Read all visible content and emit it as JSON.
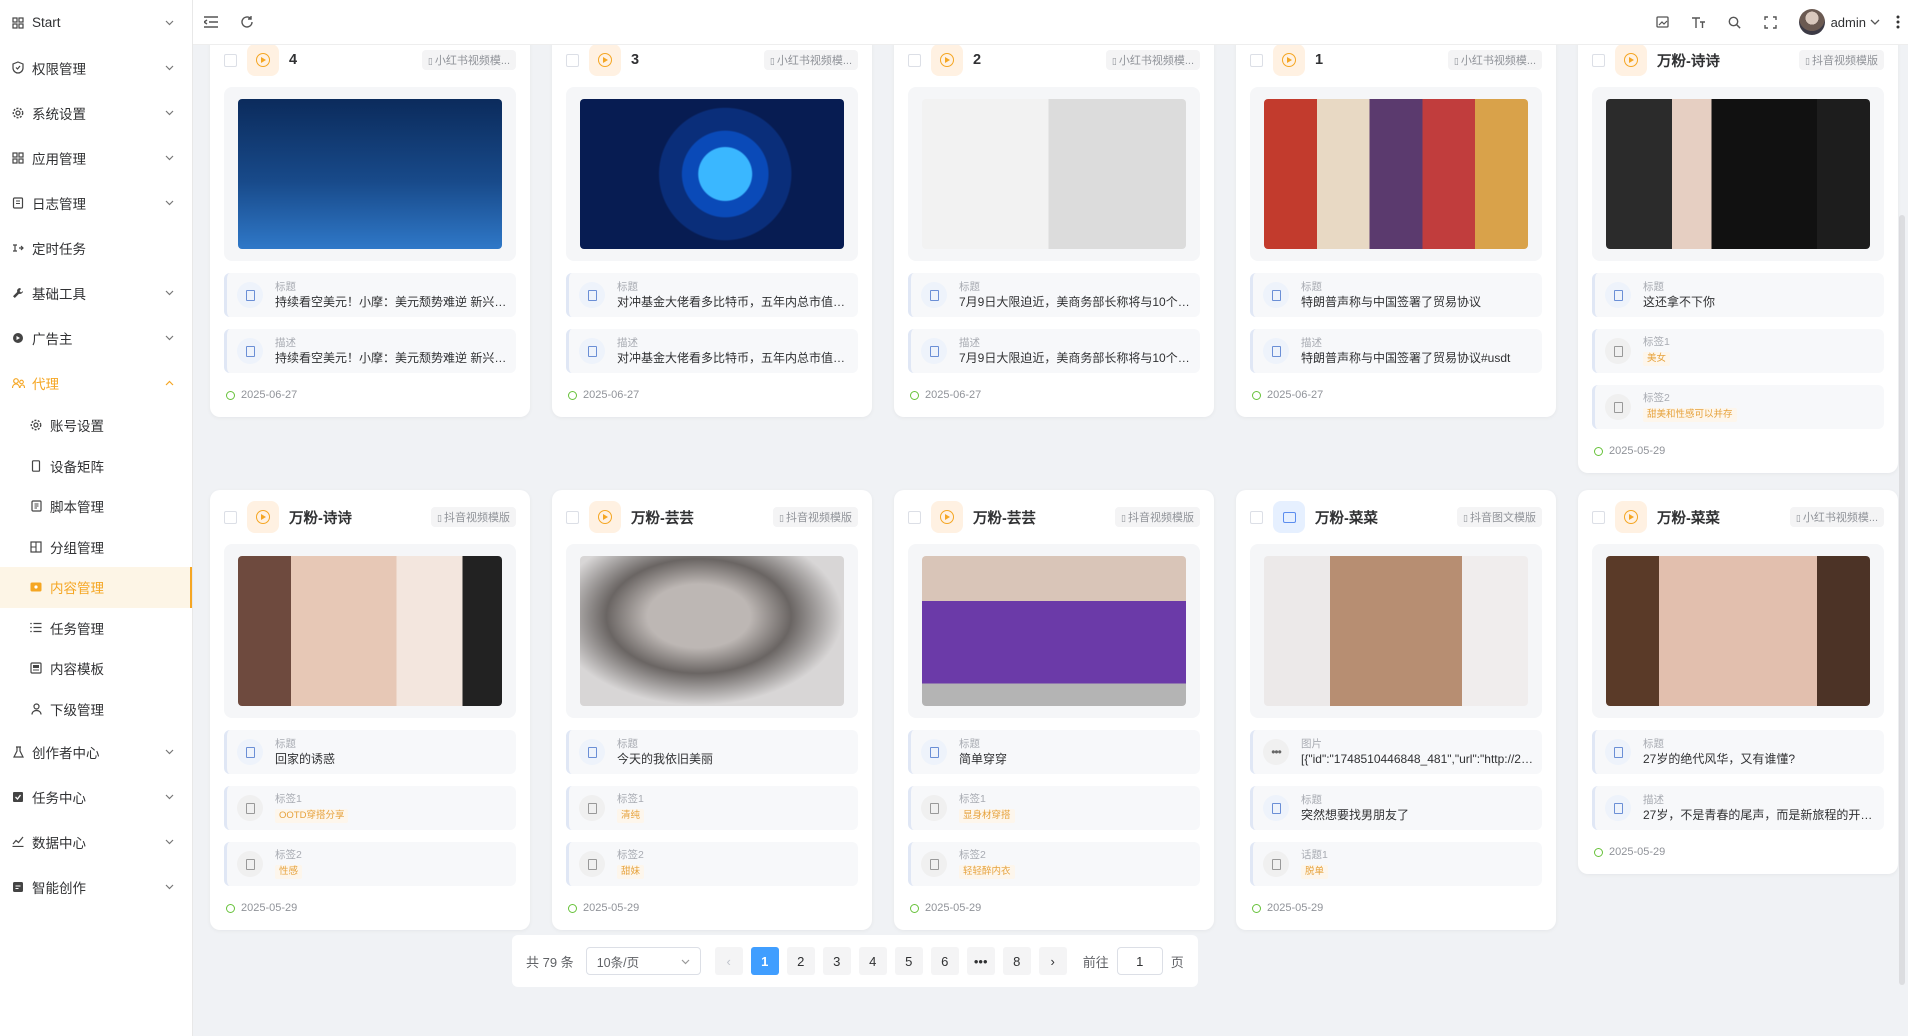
{
  "sidebar": {
    "items": [
      {
        "label": "Start",
        "icon": "grid-icon",
        "has_arrow": true
      },
      {
        "label": "权限管理",
        "icon": "shield-icon",
        "has_arrow": true
      },
      {
        "label": "系统设置",
        "icon": "gear-icon",
        "has_arrow": true
      },
      {
        "label": "应用管理",
        "icon": "grid-icon",
        "has_arrow": true
      },
      {
        "label": "日志管理",
        "icon": "log-icon",
        "has_arrow": true
      },
      {
        "label": "定时任务",
        "icon": "timer-icon",
        "has_arrow": false
      },
      {
        "label": "基础工具",
        "icon": "wrench-icon",
        "has_arrow": true
      },
      {
        "label": "广告主",
        "icon": "ad-icon",
        "has_arrow": true
      },
      {
        "label": "代理",
        "icon": "agent-icon",
        "has_arrow": true,
        "open": true
      }
    ],
    "sub_items": [
      {
        "label": "账号设置",
        "icon": "gear-icon"
      },
      {
        "label": "设备矩阵",
        "icon": "phone-icon"
      },
      {
        "label": "脚本管理",
        "icon": "script-icon"
      },
      {
        "label": "分组管理",
        "icon": "group-icon"
      },
      {
        "label": "内容管理",
        "icon": "content-icon",
        "active": true
      },
      {
        "label": "任务管理",
        "icon": "list-icon"
      },
      {
        "label": "内容模板",
        "icon": "template-icon"
      },
      {
        "label": "下级管理",
        "icon": "user-icon"
      }
    ],
    "bottom_items": [
      {
        "label": "创作者中心",
        "icon": "creator-icon",
        "has_arrow": true
      },
      {
        "label": "任务中心",
        "icon": "task-icon",
        "has_arrow": true
      },
      {
        "label": "数据中心",
        "icon": "chart-icon",
        "has_arrow": true
      },
      {
        "label": "智能创作",
        "icon": "ai-icon",
        "has_arrow": true
      }
    ]
  },
  "header": {
    "user": "admin"
  },
  "cards": [
    {
      "name": "4",
      "type": "video",
      "badge": "小红书视频模...",
      "thumb": "thumb-stock",
      "fields": [
        {
          "label": "标题",
          "value": "持续看空美元！小摩：美元颓势难逆 新兴市..."
        },
        {
          "label": "描述",
          "value": "持续看空美元！小摩：美元颓势难逆 新兴市..."
        }
      ],
      "date": "2025-06-27"
    },
    {
      "name": "3",
      "type": "video",
      "badge": "小红书视频模...",
      "thumb": "thumb-bitcoin",
      "fields": [
        {
          "label": "标题",
          "value": "对冲基金大佬看多比特币，五年内总市值将..."
        },
        {
          "label": "描述",
          "value": "对冲基金大佬看多比特币，五年内总市值将..."
        }
      ],
      "date": "2025-06-27"
    },
    {
      "name": "2",
      "type": "video",
      "badge": "小红书视频模...",
      "thumb": "thumb-cartoon",
      "fields": [
        {
          "label": "标题",
          "value": "7月9日大限迫近，美商务部长称将与10个主..."
        },
        {
          "label": "描述",
          "value": "7月9日大限迫近，美商务部长称将与10个主..."
        }
      ],
      "date": "2025-06-27"
    },
    {
      "name": "1",
      "type": "video",
      "badge": "小红书视频模...",
      "thumb": "thumb-news",
      "fields": [
        {
          "label": "标题",
          "value": "特朗普声称与中国签署了贸易协议"
        },
        {
          "label": "描述",
          "value": "特朗普声称与中国签署了贸易协议#usdt"
        }
      ],
      "date": "2025-06-27"
    },
    {
      "name": "万粉-诗诗",
      "type": "video",
      "badge": "抖音视频模版",
      "thumb": "thumb-black",
      "fields": [
        {
          "label": "标题",
          "value": "这还拿不下你"
        },
        {
          "label": "标签1",
          "tag": "美女"
        },
        {
          "label": "标签2",
          "tag": "甜美和性感可以并存"
        }
      ],
      "date": "2025-05-29"
    },
    {
      "name": "万粉-诗诗",
      "type": "video",
      "badge": "抖音视频模版",
      "thumb": "thumb-skin",
      "fields": [
        {
          "label": "标题",
          "value": "回家的诱惑"
        },
        {
          "label": "标签1",
          "tag": "OOTD穿搭分享"
        },
        {
          "label": "标签2",
          "tag": "性感"
        }
      ],
      "date": "2025-05-29"
    },
    {
      "name": "万粉-芸芸",
      "type": "video",
      "badge": "抖音视频模版",
      "thumb": "thumb-blur",
      "fields": [
        {
          "label": "标题",
          "value": "今天的我依旧美丽"
        },
        {
          "label": "标签1",
          "tag": "清纯"
        },
        {
          "label": "标签2",
          "tag": "甜妹"
        }
      ],
      "date": "2025-05-29"
    },
    {
      "name": "万粉-芸芸",
      "type": "video",
      "badge": "抖音视频模版",
      "thumb": "thumb-purple",
      "fields": [
        {
          "label": "标题",
          "value": "简单穿穿"
        },
        {
          "label": "标签1",
          "tag": "显身材穿搭"
        },
        {
          "label": "标签2",
          "tag": "轻轻醉内衣"
        }
      ],
      "date": "2025-05-29"
    },
    {
      "name": "万粉-菜菜",
      "type": "image",
      "badge": "抖音图文模版",
      "thumb": "thumb-glasses",
      "fields": [
        {
          "label": "图片",
          "value": "[{\"id\":\"1748510446848_481\",\"url\":\"http://27....",
          "icon": "dots"
        },
        {
          "label": "标题",
          "value": "突然想要找男朋友了"
        },
        {
          "label": "话题1",
          "tag": "脱单"
        }
      ],
      "date": "2025-05-29"
    },
    {
      "name": "万粉-菜菜",
      "type": "video",
      "badge": "小红书视频模...",
      "thumb": "thumb-smile",
      "fields": [
        {
          "label": "标题",
          "value": "27岁的绝代风华，又有谁懂?"
        },
        {
          "label": "描述",
          "value": "27岁，不是青春的尾声，而是新旅程的开始..."
        }
      ],
      "date": "2025-05-29"
    }
  ],
  "pagination": {
    "total": "共 79 条",
    "page_size": "10条/页",
    "pages": [
      "1",
      "2",
      "3",
      "4",
      "5",
      "6",
      "•••",
      "8"
    ],
    "current": "1",
    "goto_label": "前往",
    "goto_value": "1",
    "page_suffix": "页"
  }
}
